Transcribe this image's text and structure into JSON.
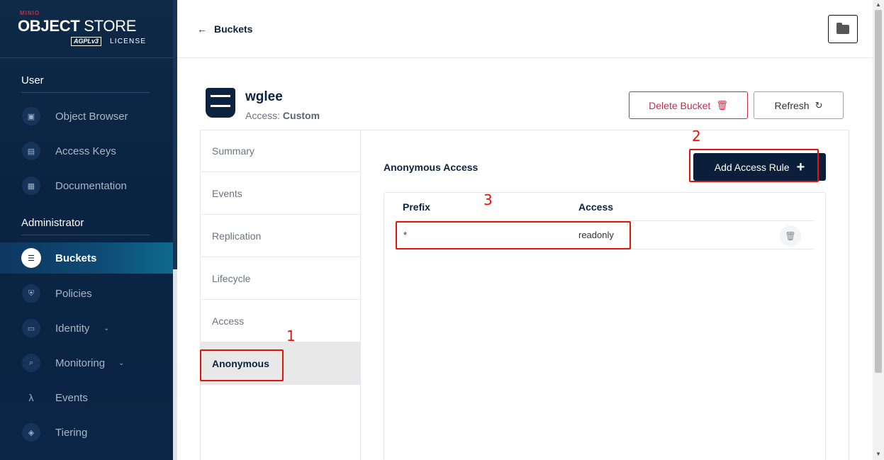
{
  "brand": {
    "minio": "MINIO",
    "title_bold": "OBJECT",
    "title_light": " STORE",
    "agpl": "AGPLv3",
    "license": "LICENSE"
  },
  "sidebar": {
    "user_section": "User",
    "user_items": [
      {
        "label": "Object Browser",
        "icon": "object-browser-icon"
      },
      {
        "label": "Access Keys",
        "icon": "access-keys-icon"
      },
      {
        "label": "Documentation",
        "icon": "documentation-icon"
      }
    ],
    "admin_section": "Administrator",
    "admin_items": [
      {
        "label": "Buckets",
        "icon": "bucket-icon",
        "active": true
      },
      {
        "label": "Policies",
        "icon": "shield-icon"
      },
      {
        "label": "Identity",
        "icon": "identity-icon",
        "expandable": true
      },
      {
        "label": "Monitoring",
        "icon": "monitoring-icon",
        "expandable": true
      },
      {
        "label": "Events",
        "icon": "lambda-icon"
      },
      {
        "label": "Tiering",
        "icon": "layers-icon"
      }
    ]
  },
  "topbar": {
    "back_label": "Buckets"
  },
  "bucket": {
    "name": "wglee",
    "access_label": "Access:",
    "access_value": "Custom"
  },
  "actions": {
    "delete_label": "Delete Bucket",
    "refresh_label": "Refresh"
  },
  "tabs": [
    "Summary",
    "Events",
    "Replication",
    "Lifecycle",
    "Access",
    "Anonymous"
  ],
  "active_tab": "Anonymous",
  "anonymous": {
    "title": "Anonymous Access",
    "add_label": "Add Access Rule",
    "columns": [
      "Prefix",
      "Access"
    ],
    "rows": [
      {
        "prefix": "*",
        "access": "readonly"
      }
    ]
  },
  "annotations": {
    "step1": "1",
    "step2": "2",
    "step3": "3"
  },
  "colors": {
    "sidebar": "#0e2a47",
    "primary": "#0b1f3a",
    "danger": "#c72c48",
    "annotation": "#e3120b"
  }
}
